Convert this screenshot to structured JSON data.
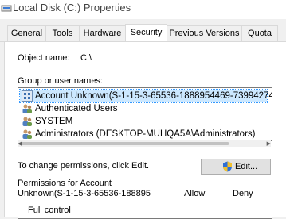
{
  "window": {
    "title": "Local Disk (C:) Properties"
  },
  "tabs": [
    {
      "label": "General"
    },
    {
      "label": "Tools"
    },
    {
      "label": "Hardware"
    },
    {
      "label": "Security",
      "active": true
    },
    {
      "label": "Previous Versions"
    },
    {
      "label": "Quota"
    }
  ],
  "security": {
    "object_name_label": "Object name:",
    "object_name_value": "C:\\",
    "group_label": "Group or user names:",
    "users": [
      {
        "name": "Account Unknown(S-1-15-3-65536-1888954469-73994274",
        "icon": "unknown-account-icon"
      },
      {
        "name": "Authenticated Users",
        "icon": "users-group-icon"
      },
      {
        "name": "SYSTEM",
        "icon": "users-group-icon"
      },
      {
        "name": "Administrators (DESKTOP-MUHQA5A\\Administrators)",
        "icon": "users-group-icon"
      }
    ],
    "change_text": "To change permissions, click Edit.",
    "edit_label": "Edit...",
    "permissions_for_line1": "Permissions for Account",
    "permissions_for_line2": "Unknown(S-1-15-3-65536-188895",
    "allow_header": "Allow",
    "deny_header": "Deny",
    "permission_first": "Full control"
  }
}
